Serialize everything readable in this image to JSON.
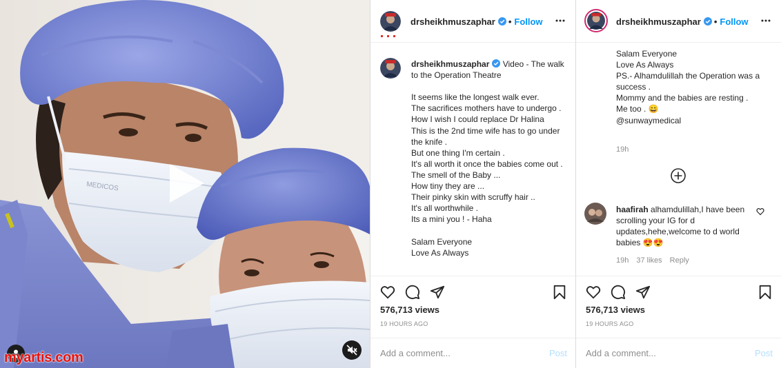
{
  "post": {
    "username": "drsheikhmuszaphar",
    "follow_label": "Follow",
    "dot": "•",
    "caption_intro": "Video - The walk to the Operation Theatre",
    "caption_body": "It seems like the longest walk ever.\nThe sacrifices mothers have to undergo .\nHow I wish I could replace Dr Halina\nThis is the 2nd time wife has to go under the knife .\nBut one thing I'm certain .\nIt's all worth it once the babies come out .\nThe smell of the Baby ...\nHow tiny they are ...\nTheir pinky skin with scruffy hair ..\nIt's all worthwhile .\nIts a mini you ! - Haha\n\nSalam Everyone\nLove As Always",
    "caption_continued": "Salam Everyone\nLove As Always\nPS.- Alhamdulillah the Operation was a success .\nMommy and the babies are resting .\nMe too . 😄\n@sunwaymedical",
    "caption_time": "19h",
    "views": "576,713 views",
    "time_ago": "19 HOURS AGO",
    "comment_placeholder": "Add a comment...",
    "post_label": "Post"
  },
  "comment": {
    "username": "haafirah",
    "text": "alhamdulillah,I have been scrolling your IG for d updates,hehe,welcome to d world babies 😍😍",
    "time": "19h",
    "likes": "37 likes",
    "reply_label": "Reply"
  },
  "video": {
    "mask_print": "MEDICOS",
    "watermark": "myartis.com"
  },
  "colors": {
    "accent": "#0095f6",
    "verified": "#3897f0",
    "watermark": "#e8120c"
  },
  "icons": [
    "play-icon",
    "mute-icon",
    "user-tag-icon",
    "verified-icon",
    "more-options-icon",
    "heart-icon",
    "comment-icon",
    "share-icon",
    "bookmark-icon",
    "add-circle-icon"
  ]
}
